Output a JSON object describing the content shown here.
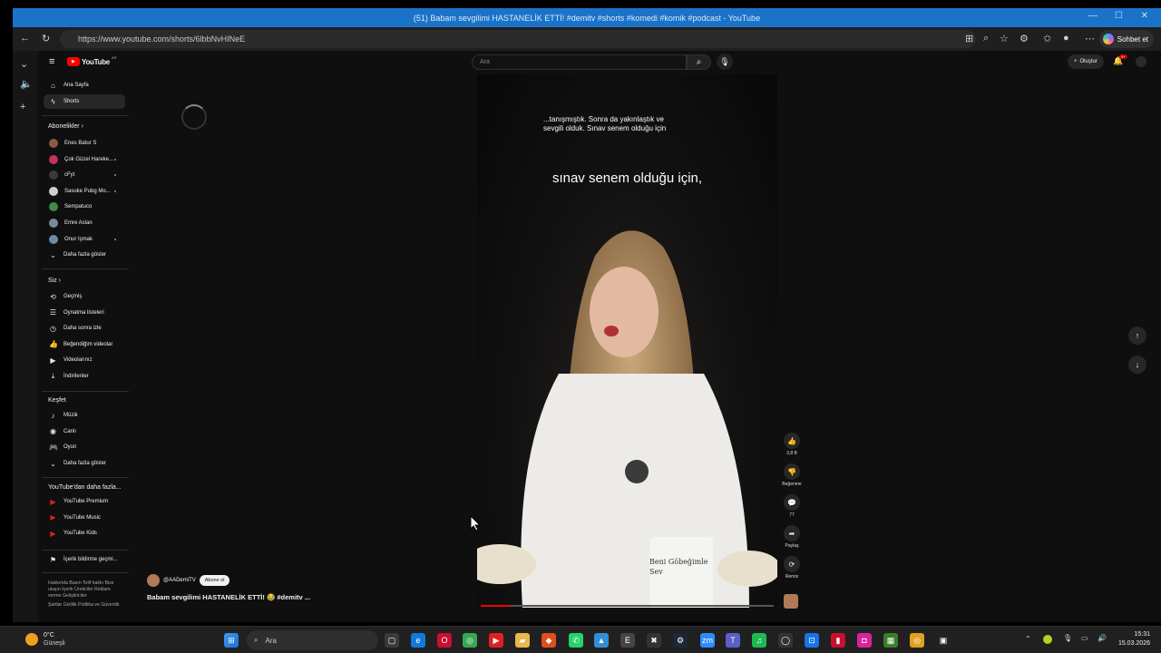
{
  "window": {
    "title": "(51) Babam sevgilimi HASTANELİK ETTİ! #demitv #shorts #komedi #komik #podcast - YouTube"
  },
  "browser": {
    "url": "https://www.youtube.com/shorts/6lbbNvHINeE",
    "chat_label": "Sohbet et"
  },
  "header": {
    "logo_text": "YouTube",
    "logo_region": "AR",
    "search_placeholder": "Ara",
    "create_label": "Oluştur",
    "notif_count": "9+"
  },
  "sidebar": {
    "main": [
      {
        "icon": "home-icon",
        "label": "Ana Sayfa"
      },
      {
        "icon": "shorts-icon",
        "label": "Shorts"
      }
    ],
    "subs_title": "Abonelikler",
    "subs": [
      {
        "label": "Enes Batur S",
        "color": "#8a5a44",
        "dot": false
      },
      {
        "label": "Çok Güzel Hareke...",
        "color": "#c2325a",
        "dot": true
      },
      {
        "label": "cFyt",
        "color": "#3a3a3a",
        "dot": true
      },
      {
        "label": "Sasuke Pubg Mo...",
        "color": "#cfcfcf",
        "dot": true
      },
      {
        "label": "Sempatuco",
        "color": "#3f8a4c",
        "dot": false
      },
      {
        "label": "Emre Aslan",
        "color": "#7a8a98",
        "dot": false
      },
      {
        "label": "Onur Işmak",
        "color": "#6d8aa8",
        "dot": true
      }
    ],
    "show_more": "Daha fazla göster",
    "you_title": "Siz",
    "you": [
      {
        "icon": "history-icon",
        "label": "Geçmiş"
      },
      {
        "icon": "playlist-icon",
        "label": "Oynatma listeleri"
      },
      {
        "icon": "clock-icon",
        "label": "Daha sonra izle"
      },
      {
        "icon": "thumbs-up-icon",
        "label": "Beğendiğim videolar"
      },
      {
        "icon": "video-icon",
        "label": "Videolarınız"
      },
      {
        "icon": "download-icon",
        "label": "İndirilenler"
      }
    ],
    "explore_title": "Keşfet",
    "explore": [
      {
        "icon": "music-icon",
        "label": "Müzik"
      },
      {
        "icon": "live-icon",
        "label": "Canlı"
      },
      {
        "icon": "game-icon",
        "label": "Oyun"
      }
    ],
    "explore_more": "Daha fazla göster",
    "more_title": "YouTube'dan daha fazla...",
    "more": [
      {
        "label": "YouTube Premium"
      },
      {
        "label": "YouTube Music"
      },
      {
        "label": "YouTube Kids"
      }
    ],
    "report_label": "İçerik bildirme geçmi...",
    "footer": "Hakkında  Basın  Telif hakkı  Bize ulaşın  İçerik Üreticiler  Reklam verme  Geliştiriciler",
    "footer2": "Şartlar  Gizlilik  Politika ve Güvenlik"
  },
  "video": {
    "caption_small": "...tanışmıştık. Sonra da yakınlaştık ve sevgili olduk. Sınav senem olduğu için",
    "caption_big": "sınav senem olduğu için,",
    "mug_text": "Beni Göbeğimle Sev",
    "progress": 0.1
  },
  "actions": {
    "likes": "3,8 B",
    "dislike": "Beğenme",
    "comments": "77",
    "share": "Paylaş",
    "remix": "Remix"
  },
  "channel": {
    "name": "@AADemiTV",
    "subscribe": "Abone ol"
  },
  "video_title": "Babam sevgilimi HASTANELİK ETTİ! 😂 #demitv ...",
  "taskbar": {
    "weather_temp": "0°C",
    "weather_desc": "Güneşli",
    "search_label": "Ara",
    "time": "15:31",
    "date": "15.03.2026"
  }
}
